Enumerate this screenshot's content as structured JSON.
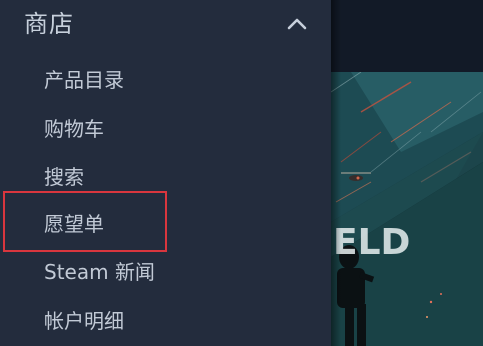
{
  "sidebar": {
    "section_title": "商店",
    "collapse_icon": "chevron-up-icon",
    "items": [
      {
        "label": "产品目录"
      },
      {
        "label": "购物车"
      },
      {
        "label": "搜索"
      },
      {
        "label": "愿望单"
      },
      {
        "label": "Steam 新闻"
      },
      {
        "label": "帐户明细"
      }
    ],
    "highlight_color": "#d9363e"
  },
  "main": {
    "hero_text": "ELD"
  },
  "colors": {
    "sidebar_bg": "#232c3d",
    "text": "#c2cad6",
    "main_bg": "#101722"
  }
}
